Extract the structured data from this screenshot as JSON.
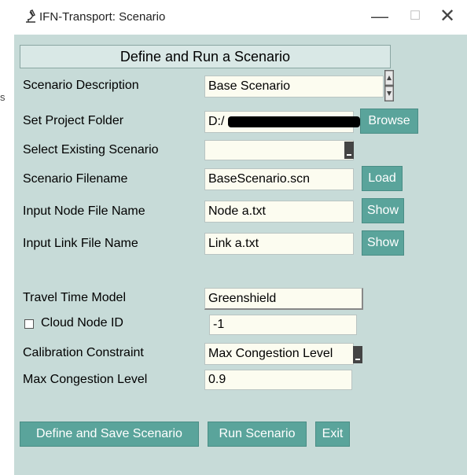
{
  "window": {
    "title": "IFN-Transport: Scenario",
    "minimize_glyph": "—",
    "maximize_glyph": "☐",
    "close_glyph": "✕"
  },
  "edge_char": "s",
  "header": {
    "title": "Define and Run a Scenario"
  },
  "form": {
    "scenario_description": {
      "label": "Scenario Description",
      "value": "Base Scenario"
    },
    "project_folder": {
      "label": "Set Project Folder",
      "value": "D:/",
      "button": "Browse"
    },
    "existing_scenario": {
      "label": "Select Existing Scenario",
      "value": ""
    },
    "scenario_filename": {
      "label": "Scenario Filename",
      "value": "BaseScenario.scn",
      "button": "Load"
    },
    "node_file": {
      "label": "Input Node File Name",
      "value": "Node a.txt",
      "button": "Show"
    },
    "link_file": {
      "label": "Input Link File Name",
      "value": "Link a.txt",
      "button": "Show"
    },
    "travel_time_model": {
      "label": "Travel Time Model",
      "value": "Greenshield"
    },
    "cloud_node": {
      "label": "Cloud Node ID",
      "value": "-1",
      "checked": false
    },
    "calibration_constraint": {
      "label": "Calibration Constraint",
      "value": "Max Congestion Level"
    },
    "max_congestion": {
      "label": "Max Congestion Level",
      "value": "0.9"
    }
  },
  "actions": {
    "define_save": "Define and Save Scenario",
    "run": "Run Scenario",
    "exit": "Exit"
  },
  "colors": {
    "background": "#c7dbd8",
    "button": "#5aa49b",
    "field": "#fcfcf0"
  }
}
